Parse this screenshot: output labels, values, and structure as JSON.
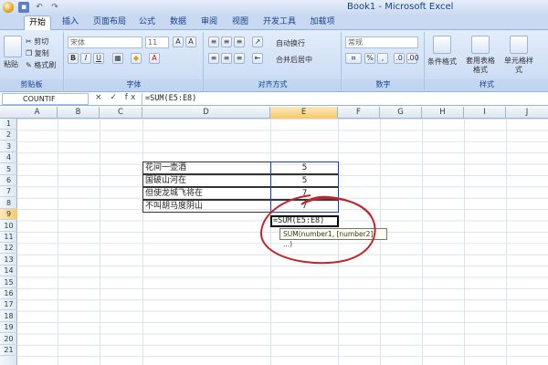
{
  "window": {
    "title": "Book1 - Microsoft Excel"
  },
  "tabs": [
    "开始",
    "插入",
    "页面布局",
    "公式",
    "数据",
    "审阅",
    "视图",
    "开发工具",
    "加载项"
  ],
  "ribbon": {
    "clipboard": {
      "label": "剪贴板",
      "paste": "粘贴",
      "cut": "剪切",
      "copy": "复制",
      "format_painter": "格式刷"
    },
    "font": {
      "label": "字体",
      "font_name": "宋体",
      "font_size": "11",
      "bold": "B",
      "italic": "I",
      "underline": "U"
    },
    "alignment": {
      "label": "对齐方式",
      "wrap": "自动换行",
      "merge": "合并后居中"
    },
    "number": {
      "label": "数字",
      "format": "常规",
      "percent": "%",
      "comma": ","
    },
    "styles": {
      "label": "样式",
      "conditional": "条件格式",
      "table": "套用表格格式",
      "cell_styles": "单元格样式"
    }
  },
  "formula_bar": {
    "name_box": "COUNTIF",
    "icons": "× ✓ fx",
    "formula": "=SUM(E5:E8)"
  },
  "columns": [
    "A",
    "B",
    "C",
    "D",
    "E",
    "F",
    "G",
    "H",
    "I",
    "J"
  ],
  "rows": [
    "1",
    "2",
    "3",
    "4",
    "5",
    "6",
    "7",
    "8",
    "9",
    "10",
    "11",
    "12",
    "13",
    "14",
    "15",
    "16",
    "17",
    "18",
    "19",
    "20",
    "21"
  ],
  "cells": {
    "D5": "花间一壶酒",
    "E5": "5",
    "D6": "国破山河在",
    "E6": "5",
    "D7": "但使龙城飞将在",
    "E7": "7",
    "D8": "不叫胡马度阴山",
    "E8": "7",
    "E9": "=SUM(E5:E8)"
  },
  "tooltip": "SUM(number1, [number2], ...)",
  "colors": {
    "annotation": "#c0262c",
    "selection_range": "#1a3bb5"
  }
}
